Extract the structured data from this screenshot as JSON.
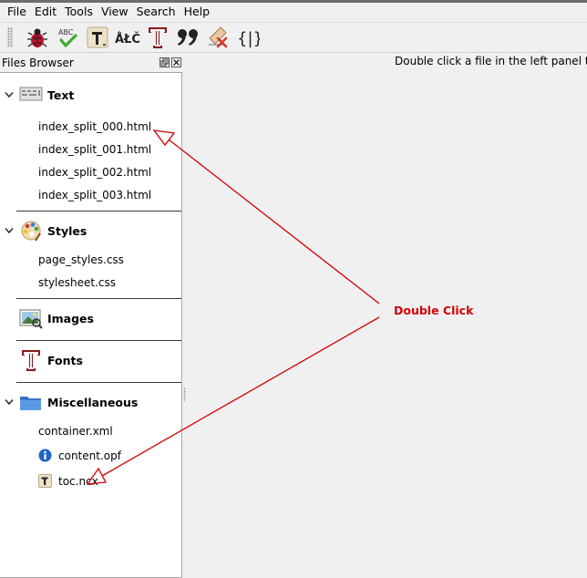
{
  "menubar": {
    "items": [
      {
        "label": "File"
      },
      {
        "label": "Edit"
      },
      {
        "label": "Tools"
      },
      {
        "label": "View"
      },
      {
        "label": "Search"
      },
      {
        "label": "Help"
      }
    ]
  },
  "toolbar": {
    "spellcheck_text": "ABC",
    "characters_text": "ÅŁČ",
    "brackets_text": "{|}"
  },
  "panel": {
    "title": "Files Browser"
  },
  "groups": {
    "text": {
      "label": "Text",
      "files": [
        "index_split_000.html",
        "index_split_001.html",
        "index_split_002.html",
        "index_split_003.html"
      ]
    },
    "styles": {
      "label": "Styles",
      "files": [
        "page_styles.css",
        "stylesheet.css"
      ]
    },
    "images": {
      "label": "Images"
    },
    "fonts": {
      "label": "Fonts"
    },
    "misc": {
      "label": "Miscellaneous",
      "files": [
        "container.xml",
        "content.opf",
        "toc.ncx"
      ]
    }
  },
  "main": {
    "message": "Double click a file in the left panel to"
  },
  "annotation": {
    "label": "Double Click",
    "color": "#d40000"
  }
}
